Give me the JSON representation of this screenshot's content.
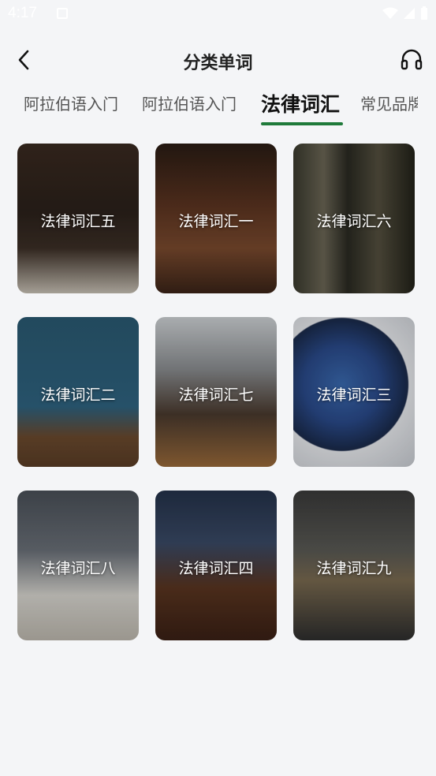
{
  "status_bar": {
    "time": "4:17"
  },
  "header": {
    "title": "分类单词"
  },
  "tabs": [
    {
      "label": "阿拉伯语入门"
    },
    {
      "label": "阿拉伯语入门"
    },
    {
      "label": "法律词汇"
    },
    {
      "label": "常见品牌"
    }
  ],
  "accent_color": "#1f7a3a",
  "cards": [
    {
      "label": "法律词汇五"
    },
    {
      "label": "法律词汇一"
    },
    {
      "label": "法律词汇六"
    },
    {
      "label": "法律词汇二"
    },
    {
      "label": "法律词汇七"
    },
    {
      "label": "法律词汇三"
    },
    {
      "label": "法律词汇八"
    },
    {
      "label": "法律词汇四"
    },
    {
      "label": "法律词汇九"
    }
  ]
}
